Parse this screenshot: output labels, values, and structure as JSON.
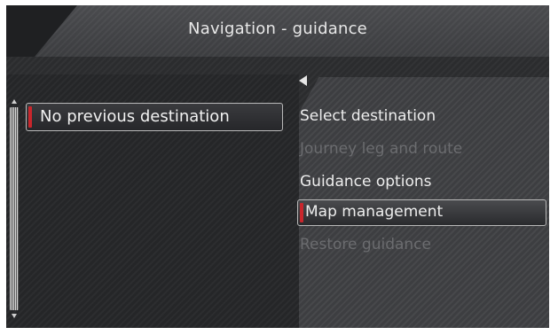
{
  "header": {
    "title": "Navigation - guidance"
  },
  "left_list": {
    "items": [
      {
        "label": "No previous destination",
        "selected": true
      }
    ]
  },
  "menu": {
    "items": [
      {
        "label": "Select destination",
        "enabled": true,
        "selected": false
      },
      {
        "label": "Journey leg and route",
        "enabled": false,
        "selected": false
      },
      {
        "label": "Guidance options",
        "enabled": true,
        "selected": false
      },
      {
        "label": "Map management",
        "enabled": true,
        "selected": true
      },
      {
        "label": "Restore guidance",
        "enabled": false,
        "selected": false
      }
    ]
  },
  "colors": {
    "accent": "#c9262c",
    "text": "#ededed",
    "disabled_text": "#6b6c6f",
    "background": "#2b2c2e"
  },
  "icons": [
    "back-arrow-icon",
    "scroll-up-icon",
    "scroll-down-icon"
  ]
}
